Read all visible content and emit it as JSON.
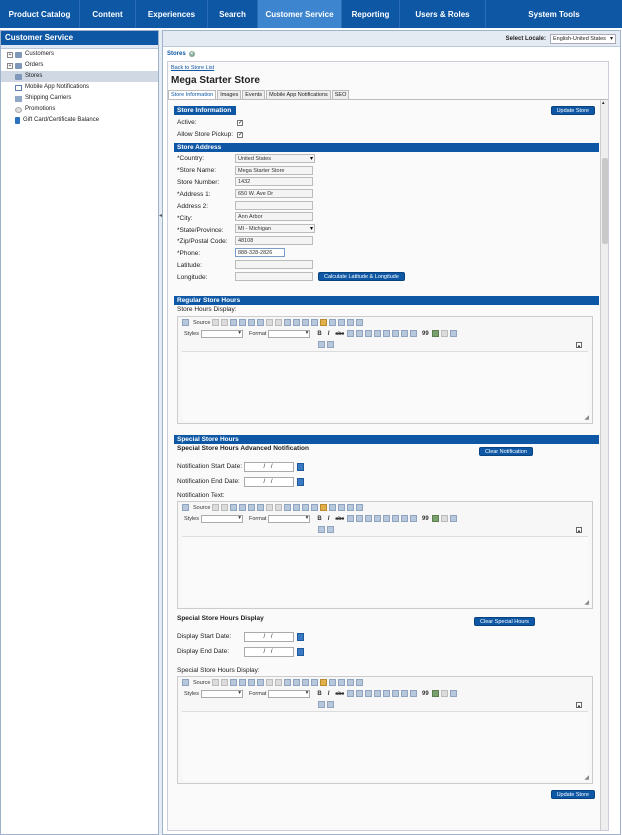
{
  "nav": {
    "items": [
      {
        "label": "Product Catalog"
      },
      {
        "label": "Content"
      },
      {
        "label": "Experiences"
      },
      {
        "label": "Search"
      },
      {
        "label": "Customer Service"
      },
      {
        "label": "Reporting"
      },
      {
        "label": "Users & Roles"
      },
      {
        "label": "System Tools"
      }
    ],
    "active": "Customer Service"
  },
  "sidebar": {
    "title": "Customer Service",
    "items": [
      {
        "label": "Customers",
        "icon": "folder-icon"
      },
      {
        "label": "Orders",
        "icon": "folder-icon"
      },
      {
        "label": "Stores",
        "icon": "folder-icon"
      },
      {
        "label": "Mobile App Notifications",
        "icon": "document-icon"
      },
      {
        "label": "Shipping Carriers",
        "icon": "truck-icon"
      },
      {
        "label": "Promotions",
        "icon": "promotion-icon"
      },
      {
        "label": "Gift Card/Certificate Balance",
        "icon": "gift-card-icon"
      }
    ]
  },
  "locale": {
    "label": "Select Locale:",
    "value": "English-United States"
  },
  "tab": {
    "label": "Stores"
  },
  "back_link": "Back to Store List",
  "store_title": "Mega Starter Store",
  "subtabs": [
    "Store Information",
    "Images",
    "Events",
    "Mobile App Notifications",
    "SEO"
  ],
  "store_info": {
    "header": "Store Information",
    "update_label": "Update Store",
    "active_label": "Active:",
    "pickup_label": "Allow Store Pickup:"
  },
  "address": {
    "header": "Store Address",
    "fields": [
      {
        "label": "*Country:",
        "value": "United States"
      },
      {
        "label": "*Store Name:",
        "value": "Mega Starter Store"
      },
      {
        "label": "Store Number:",
        "value": "1432"
      },
      {
        "label": "*Address 1:",
        "value": "650 W. Ave Dr"
      },
      {
        "label": "Address 2:",
        "value": ""
      },
      {
        "label": "*City:",
        "value": "Ann Arbor"
      },
      {
        "label": "*State/Province:",
        "value": "MI - Michigan"
      },
      {
        "label": "*Zip/Postal Code:",
        "value": "48108"
      },
      {
        "label": "*Phone:",
        "value": "888-328-2826"
      },
      {
        "label": "Latitude:",
        "value": ""
      },
      {
        "label": "Longitude:",
        "value": ""
      }
    ],
    "calc_label": "Calculate Latitude & Longitude"
  },
  "regular_hours": {
    "header": "Regular Store Hours",
    "display_label": "Store Hours Display:"
  },
  "editor": {
    "source_label": "Source",
    "styles_label": "Styles",
    "format_label": "Format",
    "bold": "B",
    "italic": "I",
    "strike": "abc",
    "quote": "99"
  },
  "special_hours": {
    "header": "Special Store Hours",
    "adv_title": "Special Store Hours Advanced Notification",
    "clear_notification_label": "Clear Notification",
    "start_label": "Notification Start Date:",
    "end_label": "Notification End Date:",
    "text_label": "Notification Text:",
    "display_title": "Special Store Hours Display",
    "clear_special_label": "Clear Special Hours",
    "display_start_label": "Display Start Date:",
    "display_end_label": "Display End Date:",
    "display_text_label": "Special Store Hours Display:",
    "date_placeholder": "/ /"
  },
  "bottom_update_label": "Update Store"
}
